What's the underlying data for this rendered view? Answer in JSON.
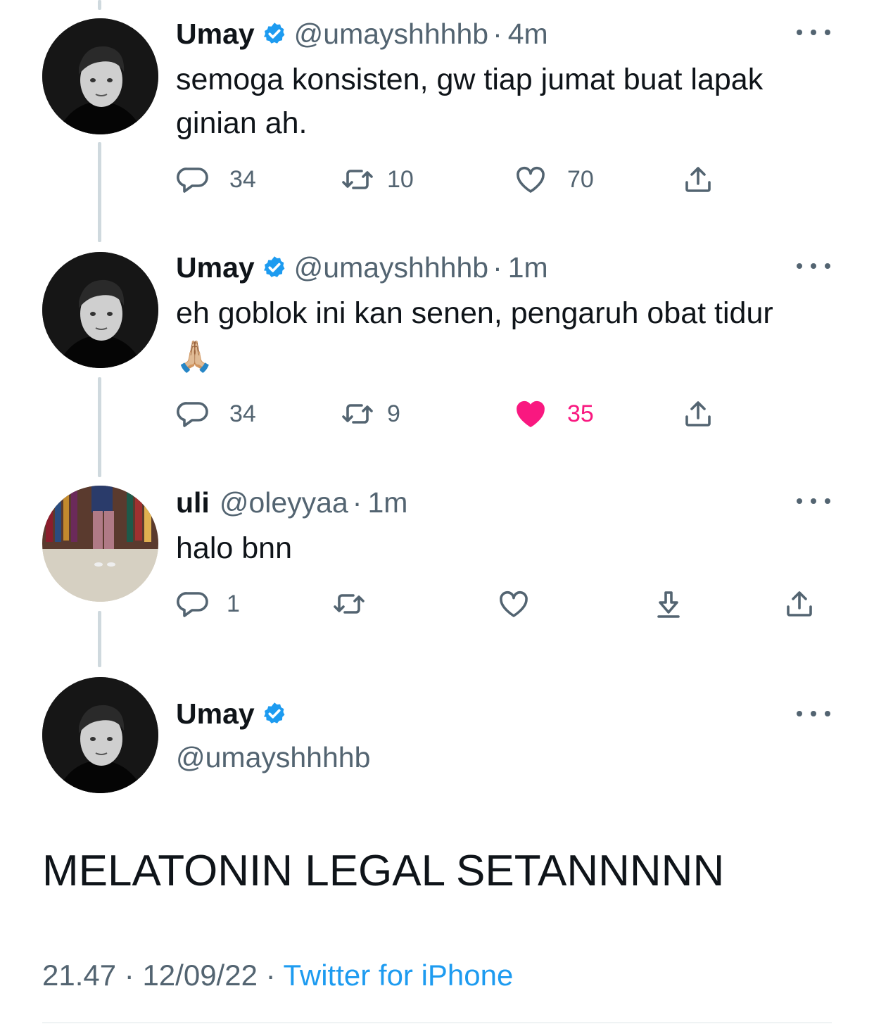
{
  "colors": {
    "text": "#0f1419",
    "secondary": "#536471",
    "accent": "#1d9bf0",
    "like_active": "#f91880",
    "thread_line": "#cfd9de"
  },
  "tweets": [
    {
      "name": "Umay",
      "handle": "@umayshhhhb",
      "separator": "·",
      "time": "4m",
      "verified": true,
      "text": "semoga konsisten, gw tiap jumat buat lapak ginian ah.",
      "replies": "34",
      "retweets": "10",
      "likes": "70",
      "liked": false
    },
    {
      "name": "Umay",
      "handle": "@umayshhhhb",
      "separator": "·",
      "time": "1m",
      "verified": true,
      "text": "eh goblok ini kan senen, pengaruh obat tidur 🙏🏼",
      "replies": "34",
      "retweets": "9",
      "likes": "35",
      "liked": true
    },
    {
      "name": "uli",
      "handle": "@oleyyaa",
      "separator": "·",
      "time": "1m",
      "verified": false,
      "text": "halo bnn",
      "replies": "1",
      "retweets": "",
      "likes": "",
      "liked": false
    }
  ],
  "main_tweet": {
    "name": "Umay",
    "handle": "@umayshhhhb",
    "verified": true,
    "text": "MELATONIN LEGAL SETANNNNN",
    "time": "21.47",
    "separator": "·",
    "date": "12/09/22",
    "source": "Twitter for iPhone"
  }
}
